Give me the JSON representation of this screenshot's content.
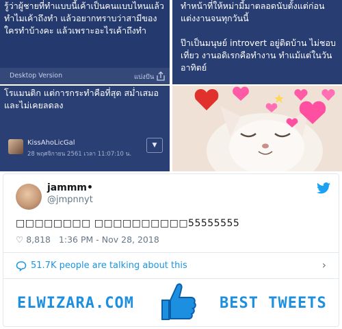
{
  "collage": {
    "top_left": {
      "lines": [
        "รู้ว่าผู้ชายที่ทำแบบนี้เค้าเป็นคนแบบไหนแล้ว",
        "ทำไมเค้าถึงทำ  แล้วอยากทราบว่าสามีของ",
        "ใครทำบ้างคะ แล้วเพราะอะไรเค้าถึงทำ"
      ],
      "desktop_version": "Desktop Version",
      "share_label": "แบ่งปัน"
    },
    "top_right": {
      "lines": [
        "ทำหน้าที่ให้หม่ามี้มาตลอดนับตั้งแต่ก่อน",
        "แต่งงานจนทุกวันนี้",
        "",
        "ป๊าเป็นมนุษย์ introvert อยู่ติดบ้าน ไม่ชอบ",
        "เที่ยว งานอดิเรกคือทำงาน ทำแม้แต่ในวัน",
        "อาทิตย์"
      ]
    },
    "bottom_left": {
      "lines": [
        "โรแมนติก แต่การกระทำคือที่สุด สม่ำเสมอ",
        "และไม่เคยลดลง"
      ],
      "username": "KissAhoLicGal",
      "date": "28 พฤศจิกายน 2561 เวลา 11:07:10 น."
    },
    "bottom_right": {
      "image": "cat-with-hearts"
    }
  },
  "tweet": {
    "display_name": "jammm•",
    "handle": "@jmpnnyt",
    "text": "□□□□□□□□ □□□□□□□□□□55555555",
    "likes": "8,818",
    "timestamp": "1:36 PM - Nov 28, 2018",
    "talking": "51.7K people are talking about this"
  },
  "footer": {
    "left_brand": "ELWIZARA.COM",
    "right_brand": "BEST TWEETS"
  },
  "colors": {
    "twitter_blue": "#1da1f2",
    "brand_blue": "#1c8fe0",
    "panel_navy": "#243a6e"
  }
}
